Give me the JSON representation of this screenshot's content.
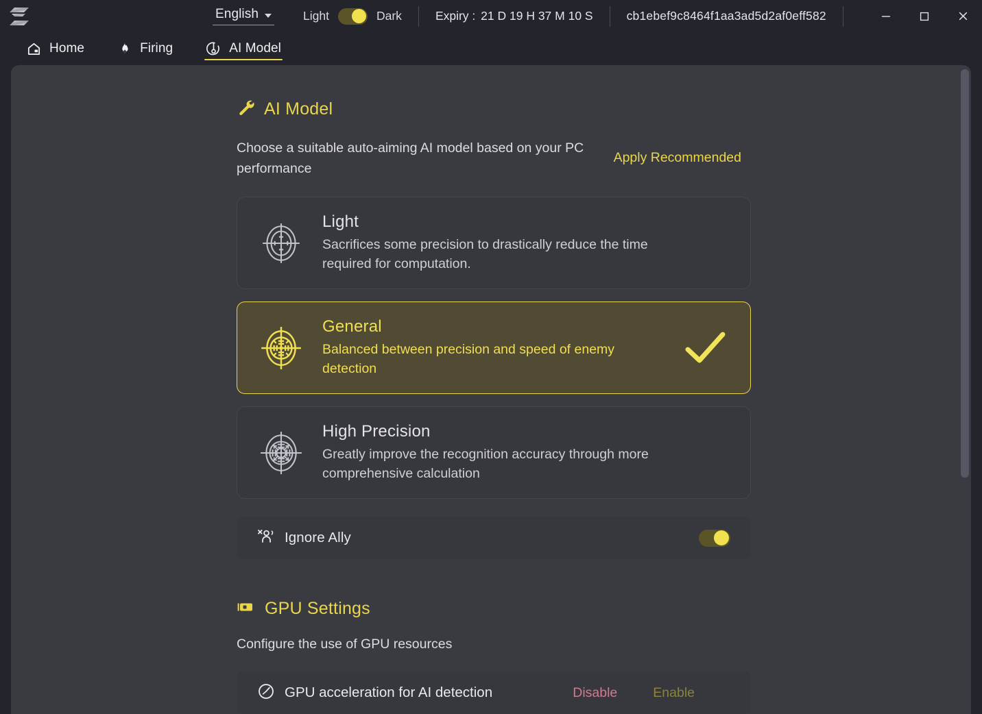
{
  "titlebar": {
    "logo_icon": "brand-s-logo",
    "language": "English",
    "theme_light_label": "Light",
    "theme_dark_label": "Dark",
    "theme_active": "Dark",
    "expiry_label": "Expiry :",
    "expiry_value": "21 D 19 H 37 M 10 S",
    "device_id": "cb1ebef9c8464f1aa3ad5d2af0eff582",
    "minimize_label": "–",
    "maximize_label": "☐",
    "close_label": "✕"
  },
  "nav": {
    "tabs": [
      {
        "label": "Home",
        "icon": "home-icon",
        "active": false
      },
      {
        "label": "Firing",
        "icon": "flame-icon",
        "active": false
      },
      {
        "label": "AI Model",
        "icon": "crosshair-icon",
        "active": true
      }
    ]
  },
  "ai_model": {
    "section_icon": "wrench-icon",
    "section_title": "AI Model",
    "description": "Choose a suitable auto-aiming AI model based on your PC performance",
    "apply_recommended": "Apply Recommended",
    "cards": [
      {
        "name": "Light",
        "description": "Sacrifices some precision to drastically reduce the time required for computation.",
        "icon": "scope-simple-icon",
        "selected": false
      },
      {
        "name": "General",
        "description": "Balanced between precision and speed of enemy detection",
        "icon": "scope-ticks-icon",
        "selected": true
      },
      {
        "name": "High Precision",
        "description": "Greatly improve the recognition accuracy through more comprehensive calculation",
        "icon": "scope-detailed-icon",
        "selected": false
      }
    ],
    "ignore_ally": {
      "label": "Ignore Ally",
      "icon": "ignore-ally-icon",
      "enabled": true
    }
  },
  "gpu": {
    "section_icon": "gpu-chip-icon",
    "section_title": "GPU Settings",
    "description": "Configure the use of GPU resources",
    "row": {
      "label": "GPU acceleration for AI detection",
      "icon": "speed-gauge-icon",
      "disable_label": "Disable",
      "enable_label": "Enable"
    }
  },
  "colors": {
    "accent": "#e9d64a",
    "window_bg": "#24252c",
    "panel_bg": "#3a3b41",
    "card_bg": "#37383d",
    "card_selected_bg": "#524b33",
    "danger": "#d4798e",
    "muted_accent": "#8c8338"
  }
}
